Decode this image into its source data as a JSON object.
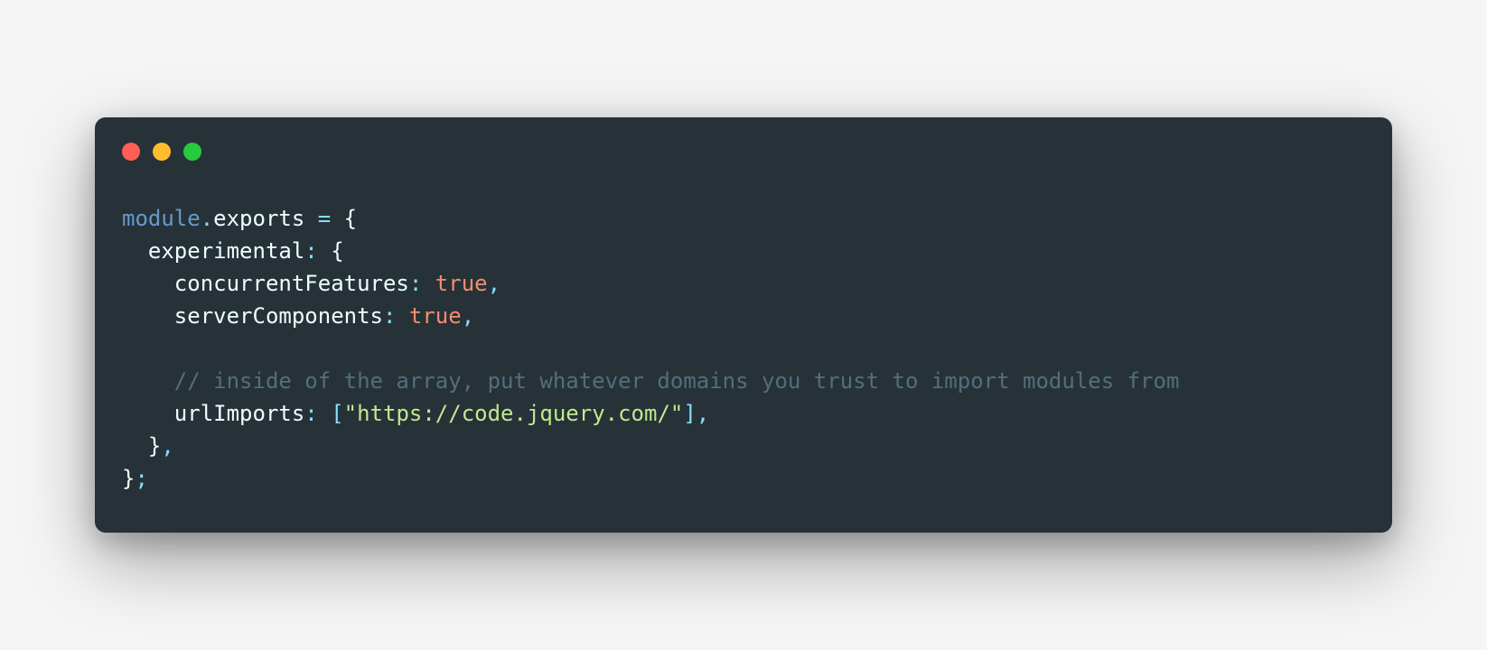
{
  "window": {
    "traffic_light_colors": {
      "red": "#ff5f56",
      "yellow": "#ffbd2e",
      "green": "#27c93f"
    }
  },
  "code": {
    "tokens": [
      [
        {
          "cls": "tok-keyword",
          "text": "module"
        },
        {
          "cls": "tok-operator",
          "text": "."
        },
        {
          "cls": "tok-property",
          "text": "exports"
        },
        {
          "cls": "tok-default",
          "text": " "
        },
        {
          "cls": "tok-operator",
          "text": "="
        },
        {
          "cls": "tok-default",
          "text": " "
        },
        {
          "cls": "tok-brace",
          "text": "{"
        }
      ],
      [
        {
          "cls": "tok-default",
          "text": "  "
        },
        {
          "cls": "tok-property",
          "text": "experimental"
        },
        {
          "cls": "tok-punct",
          "text": ":"
        },
        {
          "cls": "tok-default",
          "text": " "
        },
        {
          "cls": "tok-brace",
          "text": "{"
        }
      ],
      [
        {
          "cls": "tok-default",
          "text": "    "
        },
        {
          "cls": "tok-property",
          "text": "concurrentFeatures"
        },
        {
          "cls": "tok-punct",
          "text": ":"
        },
        {
          "cls": "tok-default",
          "text": " "
        },
        {
          "cls": "tok-bool",
          "text": "true"
        },
        {
          "cls": "tok-punct",
          "text": ","
        }
      ],
      [
        {
          "cls": "tok-default",
          "text": "    "
        },
        {
          "cls": "tok-property",
          "text": "serverComponents"
        },
        {
          "cls": "tok-punct",
          "text": ":"
        },
        {
          "cls": "tok-default",
          "text": " "
        },
        {
          "cls": "tok-bool",
          "text": "true"
        },
        {
          "cls": "tok-punct",
          "text": ","
        }
      ],
      [
        {
          "cls": "tok-default",
          "text": ""
        }
      ],
      [
        {
          "cls": "tok-default",
          "text": "    "
        },
        {
          "cls": "tok-comment",
          "text": "// inside of the array, put whatever domains you trust to import modules from"
        }
      ],
      [
        {
          "cls": "tok-default",
          "text": "    "
        },
        {
          "cls": "tok-property",
          "text": "urlImports"
        },
        {
          "cls": "tok-punct",
          "text": ":"
        },
        {
          "cls": "tok-default",
          "text": " "
        },
        {
          "cls": "tok-punct",
          "text": "["
        },
        {
          "cls": "tok-string",
          "text": "\"https://code.jquery.com/\""
        },
        {
          "cls": "tok-punct",
          "text": "]"
        },
        {
          "cls": "tok-punct",
          "text": ","
        }
      ],
      [
        {
          "cls": "tok-default",
          "text": "  "
        },
        {
          "cls": "tok-brace",
          "text": "}"
        },
        {
          "cls": "tok-punct",
          "text": ","
        }
      ],
      [
        {
          "cls": "tok-brace",
          "text": "}"
        },
        {
          "cls": "tok-punct",
          "text": ";"
        }
      ]
    ]
  }
}
